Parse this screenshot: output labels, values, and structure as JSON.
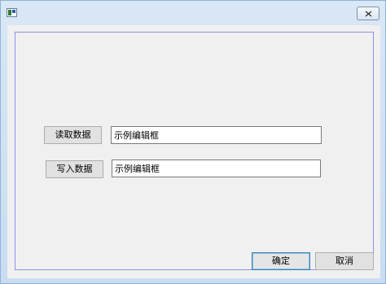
{
  "window": {
    "title": ""
  },
  "icons": {
    "app": "app-icon",
    "close": "close-icon"
  },
  "form": {
    "read_button": "读取数据",
    "read_edit_value": "示例编辑框",
    "write_button": "写入数据",
    "write_edit_value": "示例编辑框"
  },
  "footer": {
    "ok_label": "确定",
    "cancel_label": "取消"
  }
}
